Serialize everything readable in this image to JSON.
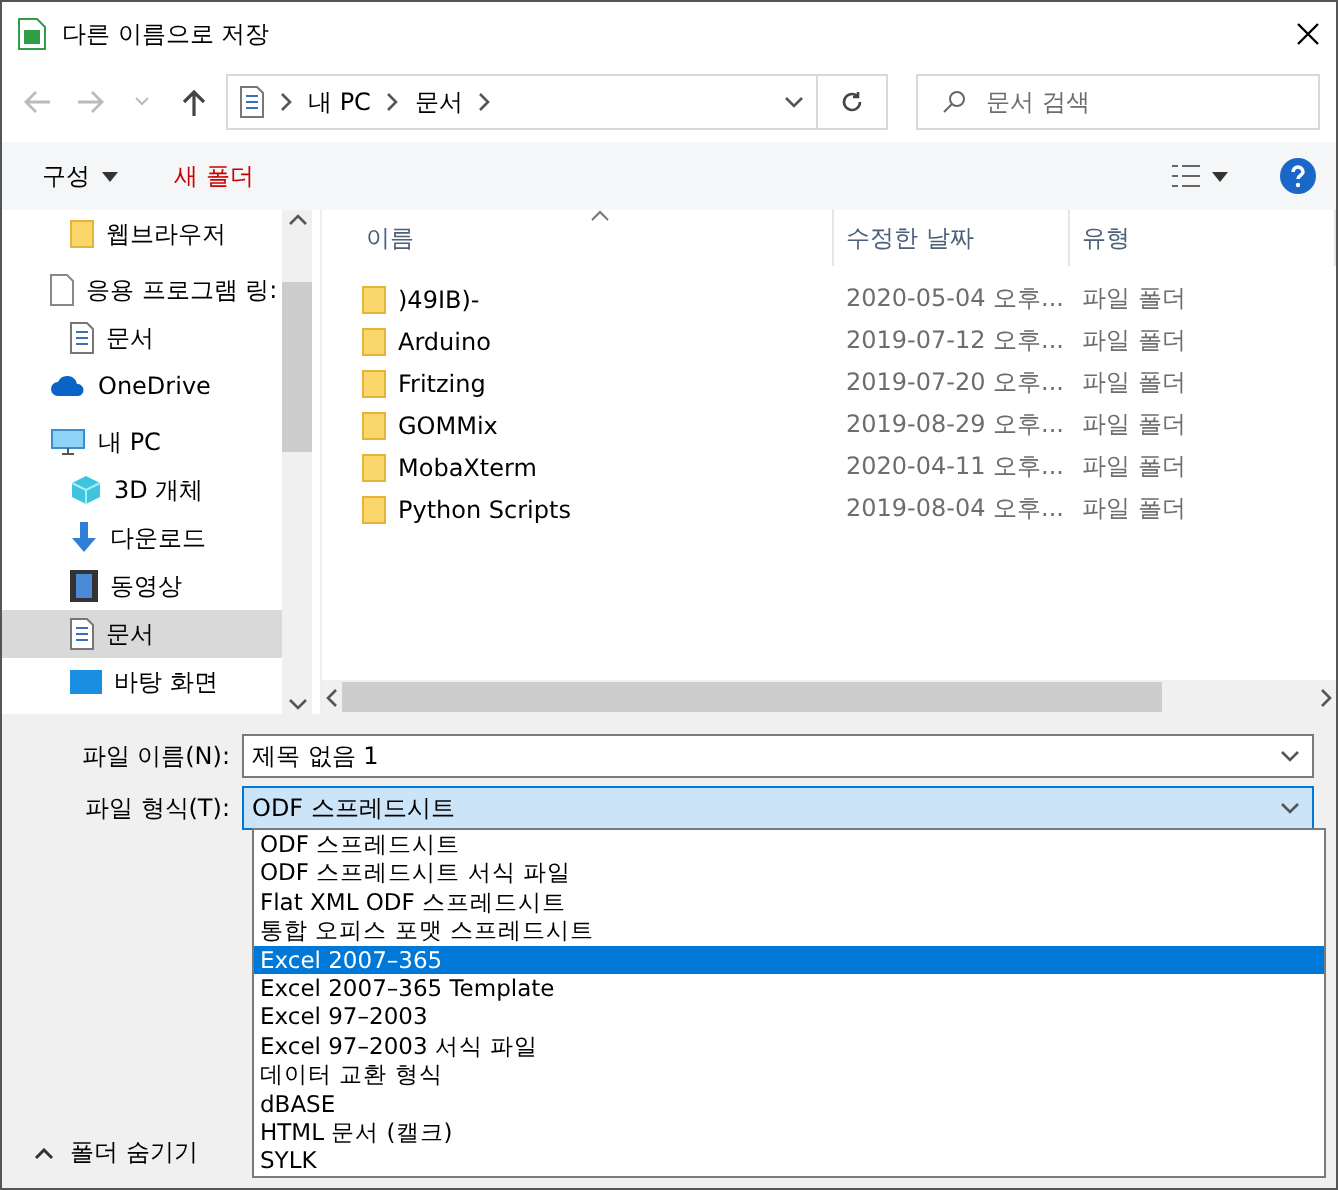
{
  "window": {
    "title": "다른 이름으로 저장"
  },
  "address": {
    "crumbs": [
      "내 PC",
      "문서"
    ]
  },
  "search": {
    "placeholder": "문서 검색"
  },
  "toolbar": {
    "organize": "구성",
    "new_folder": "새 폴더"
  },
  "sidebar": {
    "items": [
      {
        "label": "웹브라우저",
        "kind": "folder",
        "selected": false
      },
      {
        "label": "응용 프로그램 링:",
        "kind": "blank",
        "selected": false,
        "children": [
          {
            "label": "문서",
            "kind": "doc",
            "selected": false
          }
        ]
      },
      {
        "label": "OneDrive",
        "kind": "cloud",
        "selected": false
      },
      {
        "label": "내 PC",
        "kind": "pc",
        "selected": false,
        "children": [
          {
            "label": "3D 개체",
            "kind": "cube",
            "selected": false
          },
          {
            "label": "다운로드",
            "kind": "download",
            "selected": false
          },
          {
            "label": "동영상",
            "kind": "film",
            "selected": false
          },
          {
            "label": "문서",
            "kind": "doc",
            "selected": true
          },
          {
            "label": "바탕 화면",
            "kind": "desktop",
            "selected": false
          }
        ]
      }
    ]
  },
  "table": {
    "columns": [
      "이름",
      "수정한 날짜",
      "유형"
    ],
    "rows": [
      {
        "name": ")49IB)-",
        "modified": "2020-05-04 오후...",
        "type": "파일 폴더"
      },
      {
        "name": "Arduino",
        "modified": "2019-07-12 오후...",
        "type": "파일 폴더"
      },
      {
        "name": "Fritzing",
        "modified": "2019-07-20 오후...",
        "type": "파일 폴더"
      },
      {
        "name": "GOMMix",
        "modified": "2019-08-29 오후...",
        "type": "파일 폴더"
      },
      {
        "name": "MobaXterm",
        "modified": "2020-04-11 오후...",
        "type": "파일 폴더"
      },
      {
        "name": "Python Scripts",
        "modified": "2019-08-04 오후...",
        "type": "파일 폴더"
      }
    ]
  },
  "form": {
    "filename_label": "파일 이름(N):",
    "filename": "제목 없음 1",
    "type_label": "파일 형식(T):",
    "type_value": "ODF 스프레드시트",
    "type_options": [
      {
        "label": "ODF 스프레드시트",
        "selected": false
      },
      {
        "label": "ODF 스프레드시트 서식 파일",
        "selected": false
      },
      {
        "label": "Flat XML ODF 스프레드시트",
        "selected": false
      },
      {
        "label": "통합 오피스 포맷 스프레드시트",
        "selected": false
      },
      {
        "label": "Excel 2007–365",
        "selected": true
      },
      {
        "label": "Excel 2007–365 Template",
        "selected": false
      },
      {
        "label": "Excel 97–2003",
        "selected": false
      },
      {
        "label": "Excel 97–2003 서식 파일",
        "selected": false
      },
      {
        "label": "데이터 교환 형식",
        "selected": false
      },
      {
        "label": "dBASE",
        "selected": false
      },
      {
        "label": "HTML 문서 (캘크)",
        "selected": false
      },
      {
        "label": "SYLK",
        "selected": false
      }
    ]
  },
  "hide_folders": "폴더 숨기기"
}
